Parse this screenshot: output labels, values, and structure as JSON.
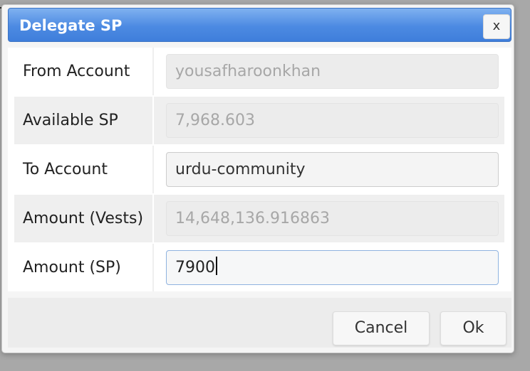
{
  "dialog": {
    "title": "Delegate SP",
    "close_label": "x"
  },
  "form": {
    "rows": [
      {
        "label": "From Account",
        "value": "yousafharoonkhan"
      },
      {
        "label": "Available SP",
        "value": "7,968.603"
      },
      {
        "label": "To Account",
        "value": "urdu-community"
      },
      {
        "label": "Amount (Vests)",
        "value": "14,648,136.916863"
      },
      {
        "label": "Amount (SP)",
        "value": "7900"
      }
    ]
  },
  "footer": {
    "cancel_label": "Cancel",
    "ok_label": "Ok"
  }
}
